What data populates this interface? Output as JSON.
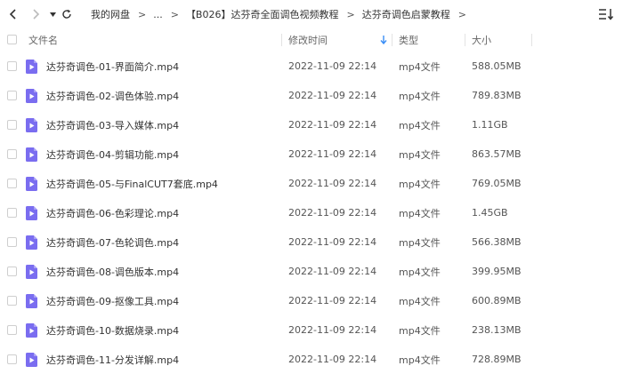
{
  "toolbar": {
    "breadcrumbs": [
      {
        "label": "我的网盘"
      },
      {
        "label": "..."
      },
      {
        "label": "【B026】达芬奇全面调色视频教程"
      },
      {
        "label": "达芬奇调色启蒙教程"
      }
    ]
  },
  "columns": {
    "name": "文件名",
    "modified": "修改时间",
    "type": "类型",
    "size": "大小"
  },
  "files": [
    {
      "name": "达芬奇调色-01-界面简介.mp4",
      "modified": "2022-11-09 22:14",
      "type": "mp4文件",
      "size": "588.05MB"
    },
    {
      "name": "达芬奇调色-02-调色体验.mp4",
      "modified": "2022-11-09 22:14",
      "type": "mp4文件",
      "size": "789.83MB"
    },
    {
      "name": "达芬奇调色-03-导入媒体.mp4",
      "modified": "2022-11-09 22:14",
      "type": "mp4文件",
      "size": "1.11GB"
    },
    {
      "name": "达芬奇调色-04-剪辑功能.mp4",
      "modified": "2022-11-09 22:14",
      "type": "mp4文件",
      "size": "863.57MB"
    },
    {
      "name": "达芬奇调色-05-与FinalCUT7套底.mp4",
      "modified": "2022-11-09 22:14",
      "type": "mp4文件",
      "size": "769.05MB"
    },
    {
      "name": "达芬奇调色-06-色彩理论.mp4",
      "modified": "2022-11-09 22:14",
      "type": "mp4文件",
      "size": "1.45GB"
    },
    {
      "name": "达芬奇调色-07-色轮调色.mp4",
      "modified": "2022-11-09 22:14",
      "type": "mp4文件",
      "size": "566.38MB"
    },
    {
      "name": "达芬奇调色-08-调色版本.mp4",
      "modified": "2022-11-09 22:14",
      "type": "mp4文件",
      "size": "399.95MB"
    },
    {
      "name": "达芬奇调色-09-抠像工具.mp4",
      "modified": "2022-11-09 22:14",
      "type": "mp4文件",
      "size": "600.89MB"
    },
    {
      "name": "达芬奇调色-10-数据烧录.mp4",
      "modified": "2022-11-09 22:14",
      "type": "mp4文件",
      "size": "238.13MB"
    },
    {
      "name": "达芬奇调色-11-分发详解.mp4",
      "modified": "2022-11-09 22:14",
      "type": "mp4文件",
      "size": "728.89MB"
    }
  ],
  "colors": {
    "file_icon": "#7a6df0",
    "sort_arrow": "#3b8ff6"
  }
}
